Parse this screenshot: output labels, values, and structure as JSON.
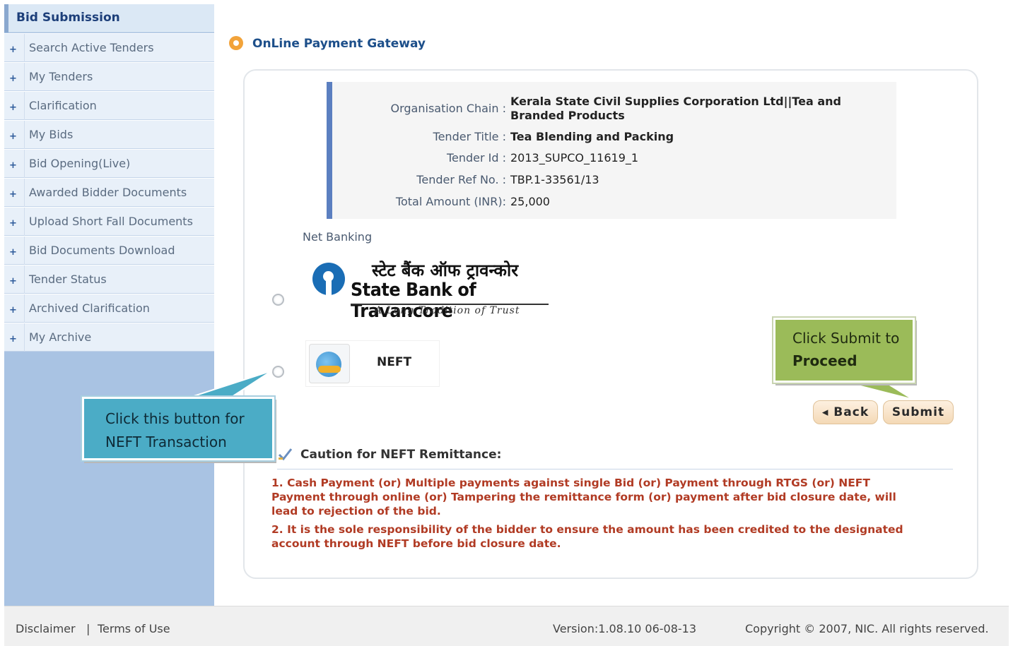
{
  "sidebar": {
    "header": "Bid Submission",
    "items": [
      {
        "label": "Search Active Tenders"
      },
      {
        "label": "My Tenders"
      },
      {
        "label": "Clarification"
      },
      {
        "label": "My Bids"
      },
      {
        "label": "Bid Opening(Live)"
      },
      {
        "label": "Awarded Bidder Documents"
      },
      {
        "label": "Upload Short Fall Documents"
      },
      {
        "label": "Bid Documents Download"
      },
      {
        "label": "Tender Status"
      },
      {
        "label": "Archived Clarification"
      },
      {
        "label": "My Archive"
      }
    ]
  },
  "page": {
    "title": "OnLine Payment Gateway"
  },
  "tender": {
    "org_label": "Organisation Chain :",
    "org_value_1": "Kerala State Civil Supplies Corporation Ltd||Tea and",
    "org_value_2": "Branded Products",
    "title_label": "Tender Title :",
    "title_value": "Tea Blending and Packing",
    "id_label": "Tender Id :",
    "id_value": "2013_SUPCO_11619_1",
    "ref_label": "Tender Ref No. :",
    "ref_value": "TBP.1-33561/13",
    "amount_label": "Total Amount (INR):",
    "amount_value": "25,000"
  },
  "payment": {
    "section_label": "Net Banking",
    "sbt_hindi": "स्टेट बैंक ऑफ ट्रावन्कोर",
    "sbt_name": "State Bank of Travancore",
    "sbt_tagline": "A Long Tradition of Trust",
    "neft_label": "NEFT"
  },
  "callouts": {
    "submit_line1": "Click Submit to",
    "submit_line2": "Proceed",
    "neft_line1": "Click this button for",
    "neft_line2": "NEFT Transaction"
  },
  "buttons": {
    "back": "◂ Back",
    "submit": "Submit"
  },
  "caution": {
    "title": "Caution for NEFT Remittance:",
    "item1_line1": "1. Cash Payment (or) Multiple payments against single Bid (or) Payment through RTGS (or) NEFT",
    "item1_line2": "Payment through online (or) Tampering the remittance form (or) payment after bid closure date, will",
    "item1_line3": "lead to rejection of the bid.",
    "item2_line1": "2. It is the sole responsibility of the bidder to ensure the amount has been credited to the designated",
    "item2_line2": "account through NEFT before bid closure date."
  },
  "footer": {
    "disclaimer": "Disclaimer",
    "separator": "|",
    "terms": "Terms of Use",
    "version": "Version:1.08.10 06-08-13",
    "copyright": "Copyright © 2007, NIC. All rights reserved."
  }
}
